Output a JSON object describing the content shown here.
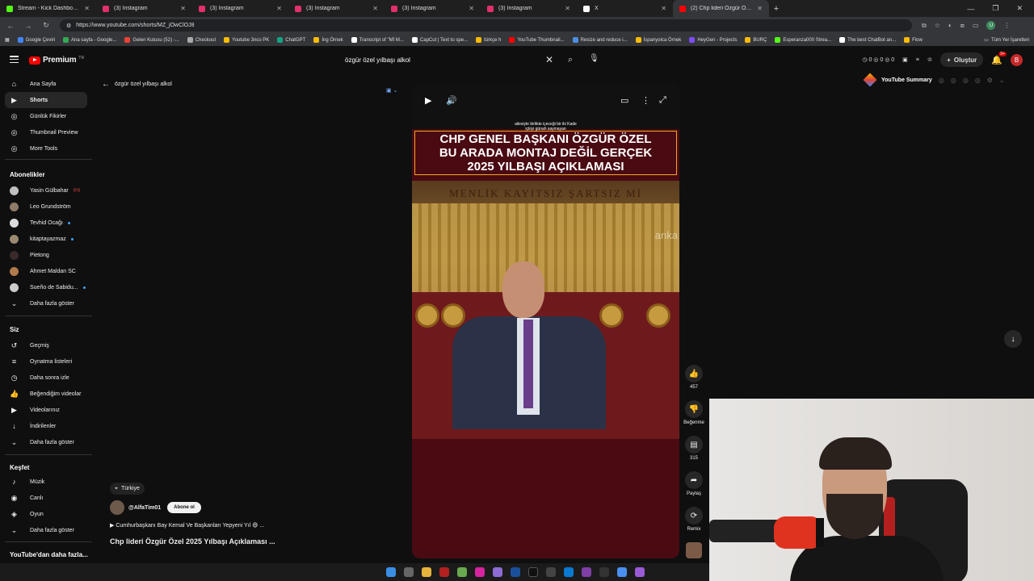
{
  "browser": {
    "tabs": [
      {
        "title": "Stream - Kick Dashboard",
        "color": "#53fc18",
        "active": false
      },
      {
        "title": "(3) Instagram",
        "color": "#e1306c",
        "active": false
      },
      {
        "title": "(3) Instagram",
        "color": "#e1306c",
        "active": false
      },
      {
        "title": "(3) Instagram",
        "color": "#e1306c",
        "active": false
      },
      {
        "title": "(3) Instagram",
        "color": "#e1306c",
        "active": false
      },
      {
        "title": "(3) Instagram",
        "color": "#e1306c",
        "active": false
      },
      {
        "title": "X",
        "color": "#ffffff",
        "active": false
      },
      {
        "title": "(2) Chp lideri Özgür Özel 2025",
        "color": "#ff0000",
        "active": true
      }
    ],
    "url": "https://www.youtube.com/shorts/MZ_jOwClOJ8",
    "profile_initial": "U",
    "bookmarks": [
      {
        "label": "Google Çeviri",
        "color": "#4285f4"
      },
      {
        "label": "Ana sayfa - Google...",
        "color": "#34a853"
      },
      {
        "label": "Gelen Kutusu (52) -...",
        "color": "#ea4335"
      },
      {
        "label": "Checkout",
        "color": "#aaaaaa"
      },
      {
        "label": "Youtube 3nco PK",
        "color": "#fbbc05"
      },
      {
        "label": "ChatGPT",
        "color": "#10a37f"
      },
      {
        "label": "İng Örnek",
        "color": "#fbbc05"
      },
      {
        "label": "Transcript of \"Mİ M...",
        "color": "#ffffff"
      },
      {
        "label": "CapCut | Text to spe...",
        "color": "#ffffff"
      },
      {
        "label": "türkçe h",
        "color": "#fbbc05"
      },
      {
        "label": "YouTube Thumbnail...",
        "color": "#ff0000"
      },
      {
        "label": "Resize and reduce i...",
        "color": "#4a90e2"
      },
      {
        "label": "İspanyolca Örnek",
        "color": "#fbbc05"
      },
      {
        "label": "HeyGen - Projects",
        "color": "#7c4dff"
      },
      {
        "label": "BURÇ",
        "color": "#fbbc05"
      },
      {
        "label": "Esperanza000 Strea...",
        "color": "#53fc18"
      },
      {
        "label": "The best ChatBot an...",
        "color": "#ffffff"
      },
      {
        "label": "Flow",
        "color": "#fbbc05"
      }
    ],
    "all_bookmarks": "Tüm Yer İşaretleri"
  },
  "header": {
    "logo_text": "Premium",
    "logo_sup": "TR",
    "search_value": "özgür özel yılbaşı alkol",
    "counts": [
      "0",
      "0",
      "0"
    ],
    "create_label": "Oluştur",
    "notif_count": "9+",
    "avatar_initial": "B"
  },
  "sidebar": {
    "main": [
      {
        "label": "Ana Sayfa",
        "icon": "⌂"
      },
      {
        "label": "Shorts",
        "icon": "▶"
      },
      {
        "label": "Günlük Fikirler",
        "icon": "◎"
      },
      {
        "label": "Thumbnail Preview",
        "icon": "◎"
      },
      {
        "label": "More Tools",
        "icon": "◎"
      }
    ],
    "subs_header": "Abonelikler",
    "subs": [
      {
        "label": "Yasin Gülbahar",
        "color": "#c0c0c0",
        "mark": "live"
      },
      {
        "label": "Leo Grundström",
        "color": "#8d7b68",
        "mark": ""
      },
      {
        "label": "Tevhid Ocağı",
        "color": "#dddddd",
        "mark": "dot"
      },
      {
        "label": "kitaptayazmaz",
        "color": "#9a8a70",
        "mark": "dot"
      },
      {
        "label": "Pietong",
        "color": "#3a2a2a",
        "mark": ""
      },
      {
        "label": "Ahmet Maldan SC",
        "color": "#b07a4a",
        "mark": ""
      },
      {
        "label": "Sueño de Sabidu...",
        "color": "#cccccc",
        "mark": "dot"
      }
    ],
    "subs_more": "Daha fazla göster",
    "you_header": "Siz",
    "you": [
      {
        "label": "Geçmiş",
        "icon": "↺"
      },
      {
        "label": "Oynatma listeleri",
        "icon": "≡"
      },
      {
        "label": "Daha sonra izle",
        "icon": "◷"
      },
      {
        "label": "Beğendiğim videolar",
        "icon": "👍"
      },
      {
        "label": "Videolarınız",
        "icon": "▶"
      },
      {
        "label": "İndirilenler",
        "icon": "↓"
      },
      {
        "label": "Daha fazla göster",
        "icon": "⌄"
      }
    ],
    "explore_header": "Keşfet",
    "explore": [
      {
        "label": "Müzik",
        "icon": "♪"
      },
      {
        "label": "Canlı",
        "icon": "◉"
      },
      {
        "label": "Oyun",
        "icon": "◈"
      },
      {
        "label": "Daha fazla göster",
        "icon": "⌄"
      }
    ],
    "more_header": "YouTube'dan daha fazla..."
  },
  "main": {
    "back_label": "özgür özel yılbaşı alkol",
    "caption_small_1": "ailesiyle birlikte içeceği bir iki Kade",
    "caption_small_2": "içkiyi günah saymayan",
    "headline_1": "CHP GENEL BAŞKANI ÖZGÜR ÖZEL",
    "headline_2": "BU ARADA MONTAJ DEĞİL GERÇEK",
    "headline_3": "2025 YILBAŞI AÇIKLAMASI",
    "banner_text": "MENLİK KAYITSIZ ŞARTSIZ Mİ",
    "watermark": "anka",
    "likes": "457",
    "dislike_label": "Beğenme",
    "comments": "315",
    "share_label": "Paylaş",
    "remix_label": "Remix",
    "location": "Türkiye",
    "channel": "@AlfaTim01",
    "follow_label": "Abone ol",
    "description": "▶ Cumhurbaşkanı Bay Kemal Ve Başkanları Yepyeni Yıl 😄 ...",
    "title": "Chp lideri Özgür Özel 2025 Yılbaşı Açıklaması ..."
  },
  "summary": {
    "label": "YouTube Summary"
  },
  "colors": {
    "accent": "#ff0000",
    "video_bg": "#4a0a12",
    "headline_border": "#f5a623"
  }
}
